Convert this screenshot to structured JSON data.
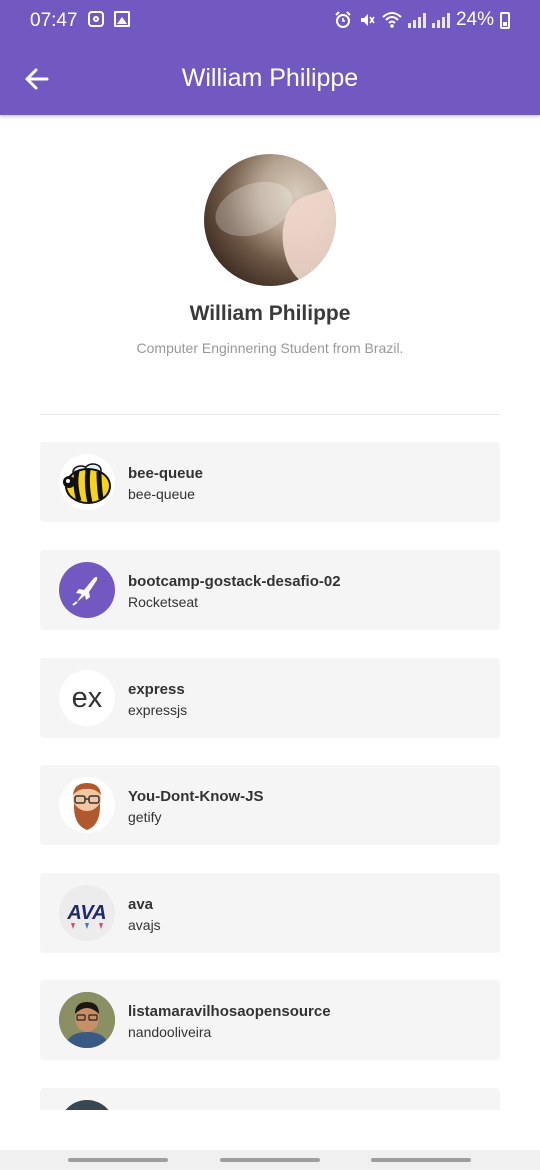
{
  "status_bar": {
    "time": "07:47",
    "battery": "24%",
    "icons": [
      "instagram-icon",
      "gallery-icon",
      "alarm-icon",
      "mute-icon",
      "wifi-icon",
      "signal-icon",
      "signal-icon",
      "battery-icon"
    ]
  },
  "app_bar": {
    "title": "William Philippe",
    "back_icon": "arrow-left-icon",
    "color": "#7159c1"
  },
  "profile": {
    "name": "William Philippe",
    "bio": "Computer Enginnering Student from Brazil."
  },
  "repos": [
    {
      "name": "bee-queue",
      "owner": "bee-queue"
    },
    {
      "name": "bootcamp-gostack-desafio-02",
      "owner": "Rocketseat"
    },
    {
      "name": "express",
      "owner": "expressjs"
    },
    {
      "name": "You-Dont-Know-JS",
      "owner": "getify"
    },
    {
      "name": "ava",
      "owner": "avajs"
    },
    {
      "name": "listamaravilhosaopensource",
      "owner": "nandooliveira"
    }
  ],
  "avatar_labels": {
    "express": "ex",
    "ava": "AVA"
  }
}
